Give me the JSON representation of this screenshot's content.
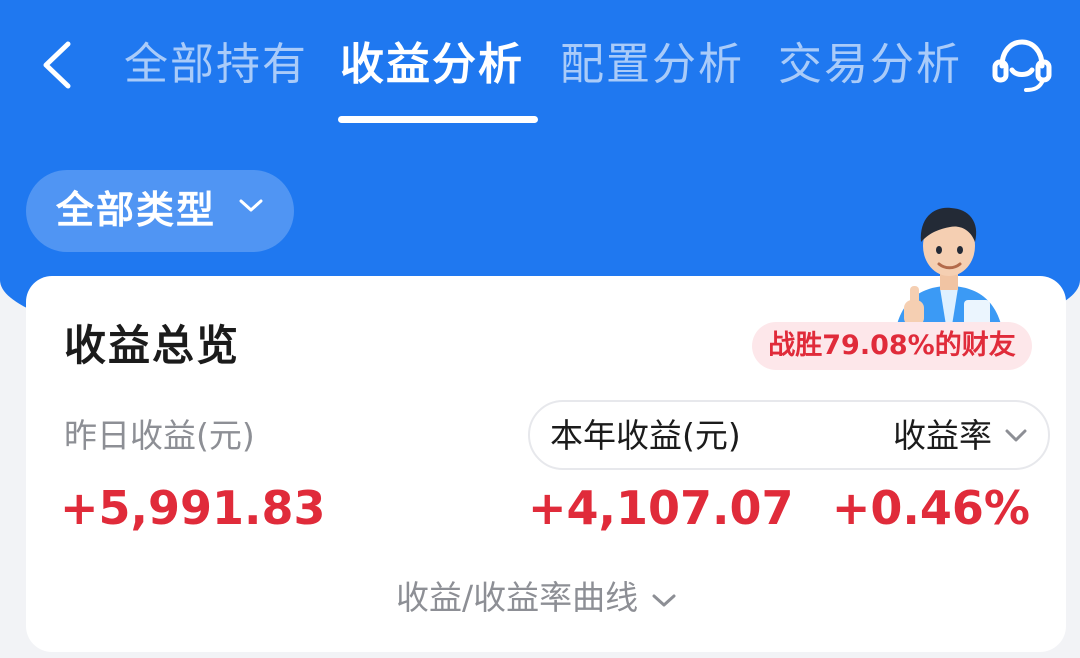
{
  "colors": {
    "brand_blue": "#1f78f0",
    "profit_red": "#e02b3a",
    "badge_bg": "#fde7ea",
    "muted_gray": "#8d8f95"
  },
  "header": {
    "back_icon": "chevron-left-icon",
    "tabs": [
      {
        "label": "全部持有",
        "active": false
      },
      {
        "label": "收益分析",
        "active": true
      },
      {
        "label": "配置分析",
        "active": false
      },
      {
        "label": "交易分析",
        "active": false
      }
    ],
    "service_icon": "customer-service-icon"
  },
  "filter": {
    "label": "全部类型",
    "icon": "chevron-down-icon"
  },
  "overview": {
    "title": "收益总览",
    "mascot_icon": "thumbs-up-mascot",
    "rank_badge": "战胜79.08%的财友",
    "yesterday": {
      "label": "昨日收益(元)",
      "value": "+5,991.83"
    },
    "year": {
      "label": "本年收益(元)",
      "value": "+4,107.07"
    },
    "rate": {
      "label": "收益率",
      "value": "+0.46%",
      "icon": "chevron-down-icon"
    },
    "curve_toggle": {
      "label": "收益/收益率曲线",
      "icon": "chevron-down-icon"
    }
  }
}
